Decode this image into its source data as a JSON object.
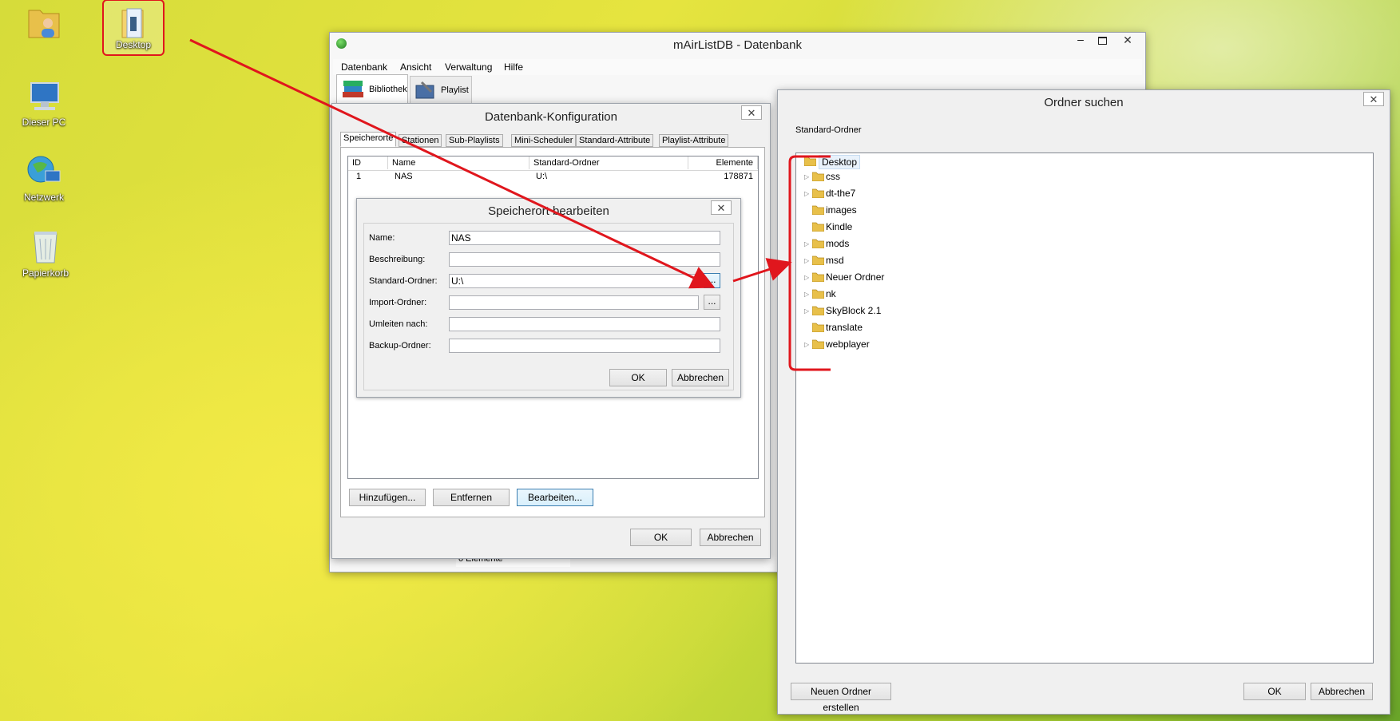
{
  "desktop": {
    "icons": [
      {
        "label": "",
        "icon": "user-folder-icon"
      },
      {
        "label": "Desktop",
        "icon": "folder-icon"
      },
      {
        "label": "Dieser PC",
        "icon": "computer-icon"
      },
      {
        "label": "Netzwerk",
        "icon": "network-icon"
      },
      {
        "label": "Papierkorb",
        "icon": "recycle-bin-icon"
      }
    ]
  },
  "main_window": {
    "title": "mAirListDB - Datenbank",
    "menu": [
      "Datenbank",
      "Ansicht",
      "Verwaltung",
      "Hilfe"
    ],
    "tabs": [
      {
        "label": "Bibliothek",
        "icon": "books-icon"
      },
      {
        "label": "Playlist",
        "icon": "playlist-icon"
      }
    ],
    "status": "0 Elemente"
  },
  "config_dialog": {
    "title": "Datenbank-Konfiguration",
    "tabs": [
      "Speicherorte",
      "Stationen",
      "Sub-Playlists",
      "Mini-Scheduler",
      "Standard-Attribute",
      "Playlist-Attribute"
    ],
    "columns": [
      "ID",
      "Name",
      "Standard-Ordner",
      "Elemente"
    ],
    "rows": [
      {
        "id": "1",
        "name": "NAS",
        "folder": "U:\\",
        "count": "178871"
      }
    ],
    "buttons": {
      "add": "Hinzufügen...",
      "remove": "Entfernen",
      "edit": "Bearbeiten...",
      "ok": "OK",
      "cancel": "Abbrechen"
    }
  },
  "edit_dialog": {
    "title": "Speicherort bearbeiten",
    "fields": [
      {
        "label": "Name:",
        "value": "NAS"
      },
      {
        "label": "Beschreibung:",
        "value": ""
      },
      {
        "label": "Standard-Ordner:",
        "value": "U:\\"
      },
      {
        "label": "Import-Ordner:",
        "value": ""
      },
      {
        "label": "Umleiten nach:",
        "value": ""
      },
      {
        "label": "Backup-Ordner:",
        "value": ""
      }
    ],
    "browse_label": "...",
    "buttons": {
      "ok": "OK",
      "cancel": "Abbrechen"
    }
  },
  "folder_dialog": {
    "title": "Ordner suchen",
    "subtitle": "Standard-Ordner",
    "root": "Desktop",
    "items": [
      {
        "name": "css",
        "expandable": true
      },
      {
        "name": "dt-the7",
        "expandable": true
      },
      {
        "name": "images",
        "expandable": false
      },
      {
        "name": "Kindle",
        "expandable": false
      },
      {
        "name": "mods",
        "expandable": true
      },
      {
        "name": "msd",
        "expandable": true
      },
      {
        "name": "Neuer Ordner",
        "expandable": true
      },
      {
        "name": "nk",
        "expandable": true
      },
      {
        "name": "SkyBlock 2.1",
        "expandable": true
      },
      {
        "name": "translate",
        "expandable": false
      },
      {
        "name": "webplayer",
        "expandable": true
      }
    ],
    "buttons": {
      "new_folder": "Neuen Ordner erstellen",
      "ok": "OK",
      "cancel": "Abbrechen"
    }
  },
  "annotation_color": "#e0161d"
}
